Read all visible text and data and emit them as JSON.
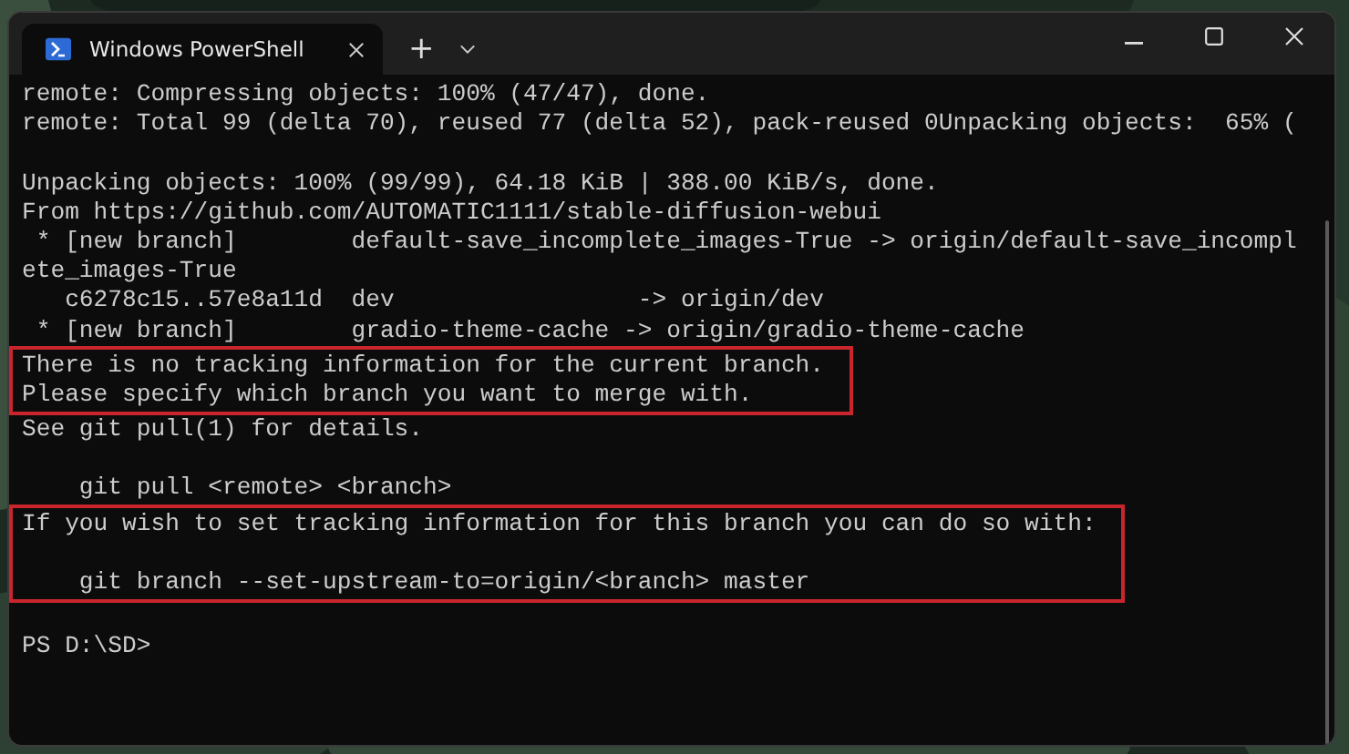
{
  "window": {
    "tabs": [
      {
        "title": "Windows PowerShell",
        "selected": true
      }
    ],
    "new_tab": "+"
  },
  "terminal": {
    "sections": [
      {
        "highlighted": false,
        "lines": [
          {
            "text": "remote: Compressing objects: 100% (47/47), done."
          },
          {
            "text": "remote: Total 99 (delta 70), reused 77 (delta 52), pack-reused 0Unpacking objects:  65% ("
          },
          {
            "text": "Unpacking objects: 100% (99/99), 64.18 KiB | 388.00 KiB/s, done.",
            "blank_before": true
          },
          {
            "text": "From https://github.com/AUTOMATIC1111/stable-diffusion-webui"
          },
          {
            "text": " * [new branch]        default-save_incomplete_images-True -> origin/default-save_incompl"
          },
          {
            "text": "ete_images-True"
          },
          {
            "text": "   c6278c15..57e8a11d  dev                 -> origin/dev"
          },
          {
            "text": " * [new branch]        gradio-theme-cache -> origin/gradio-theme-cache"
          }
        ]
      },
      {
        "highlighted": true,
        "lines": [
          {
            "text": "There is no tracking information for the current branch."
          },
          {
            "text": "Please specify which branch you want to merge with."
          }
        ]
      },
      {
        "highlighted": false,
        "lines": [
          {
            "text": "See git pull(1) for details."
          },
          {
            "text": "    git pull <remote> <branch>",
            "blank_before": true
          }
        ]
      },
      {
        "highlighted": true,
        "lines": [
          {
            "text": "If you wish to set tracking information for this branch you can do so with:"
          },
          {
            "text": "    git branch --set-upstream-to=origin/<branch> master",
            "blank_before": true
          }
        ]
      },
      {
        "highlighted": false,
        "lines": [
          {
            "text": "PS D:\\SD>",
            "blank_before": true
          }
        ]
      }
    ]
  }
}
